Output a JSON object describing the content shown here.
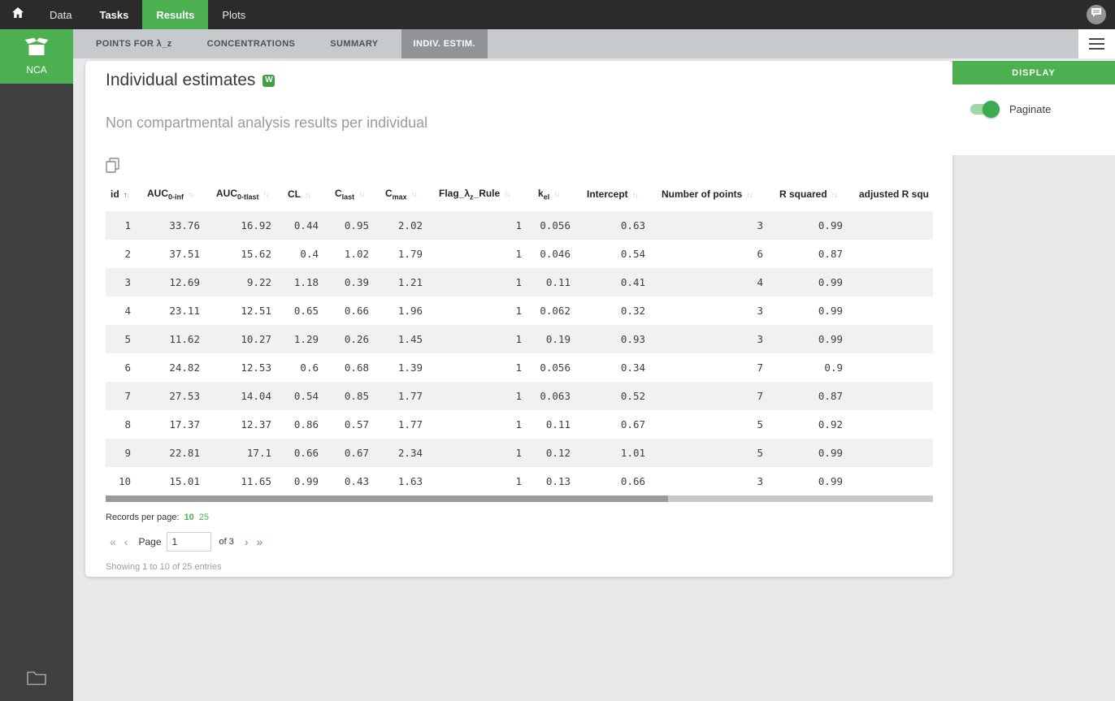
{
  "topbar": {
    "nav": [
      {
        "label": "Data"
      },
      {
        "label": "Tasks"
      },
      {
        "label": "Results"
      },
      {
        "label": "Plots"
      }
    ]
  },
  "result_tabs": [
    {
      "label": "POINTS FOR λ_z"
    },
    {
      "label": "CONCENTRATIONS"
    },
    {
      "label": "SUMMARY"
    },
    {
      "label": "INDIV. ESTIM."
    }
  ],
  "sidebar": {
    "project_label": "NCA"
  },
  "main": {
    "title": "Individual estimates",
    "word_icon_letter": "W",
    "subtitle": "Non compartmental analysis results per individual",
    "table": {
      "headers": [
        {
          "base": "id",
          "sub": "",
          "suffix": "",
          "sorted": "asc"
        },
        {
          "base": "AUC",
          "sub": "0-inf",
          "suffix": "",
          "sorted": ""
        },
        {
          "base": "AUC",
          "sub": "0-tlast",
          "suffix": "",
          "sorted": ""
        },
        {
          "base": "CL",
          "sub": "",
          "suffix": "",
          "sorted": ""
        },
        {
          "base": "C",
          "sub": "last",
          "suffix": "",
          "sorted": ""
        },
        {
          "base": "C",
          "sub": "max",
          "suffix": "",
          "sorted": ""
        },
        {
          "base": "Flag_λ",
          "sub": "z",
          "suffix": "_Rule",
          "sorted": ""
        },
        {
          "base": "k",
          "sub": "el",
          "suffix": "",
          "sorted": ""
        },
        {
          "base": "Intercept",
          "sub": "",
          "suffix": "",
          "sorted": ""
        },
        {
          "base": "Number of points",
          "sub": "",
          "suffix": "",
          "sorted": ""
        },
        {
          "base": "R squared",
          "sub": "",
          "suffix": "",
          "sorted": ""
        },
        {
          "base": "adjusted R squ",
          "sub": "",
          "suffix": "",
          "sorted": ""
        }
      ],
      "rows": [
        [
          "1",
          "33.76",
          "16.92",
          "0.44",
          "0.95",
          "2.02",
          "1",
          "0.056",
          "0.63",
          "3",
          "0.99",
          ""
        ],
        [
          "2",
          "37.51",
          "15.62",
          "0.4",
          "1.02",
          "1.79",
          "1",
          "0.046",
          "0.54",
          "6",
          "0.87",
          ""
        ],
        [
          "3",
          "12.69",
          "9.22",
          "1.18",
          "0.39",
          "1.21",
          "1",
          "0.11",
          "0.41",
          "4",
          "0.99",
          ""
        ],
        [
          "4",
          "23.11",
          "12.51",
          "0.65",
          "0.66",
          "1.96",
          "1",
          "0.062",
          "0.32",
          "3",
          "0.99",
          ""
        ],
        [
          "5",
          "11.62",
          "10.27",
          "1.29",
          "0.26",
          "1.45",
          "1",
          "0.19",
          "0.93",
          "3",
          "0.99",
          ""
        ],
        [
          "6",
          "24.82",
          "12.53",
          "0.6",
          "0.68",
          "1.39",
          "1",
          "0.056",
          "0.34",
          "7",
          "0.9",
          ""
        ],
        [
          "7",
          "27.53",
          "14.04",
          "0.54",
          "0.85",
          "1.77",
          "1",
          "0.063",
          "0.52",
          "7",
          "0.87",
          ""
        ],
        [
          "8",
          "17.37",
          "12.37",
          "0.86",
          "0.57",
          "1.77",
          "1",
          "0.11",
          "0.67",
          "5",
          "0.92",
          ""
        ],
        [
          "9",
          "22.81",
          "17.1",
          "0.66",
          "0.67",
          "2.34",
          "1",
          "0.12",
          "1.01",
          "5",
          "0.99",
          ""
        ],
        [
          "10",
          "15.01",
          "11.65",
          "0.99",
          "0.43",
          "1.63",
          "1",
          "0.13",
          "0.66",
          "3",
          "0.99",
          ""
        ]
      ]
    },
    "records_per_page": {
      "label": "Records per page:",
      "options": [
        "10",
        "25"
      ],
      "selected": "10"
    },
    "pagination": {
      "first": "«",
      "prev": "‹",
      "page_label": "Page",
      "current_page": "1",
      "of_label": "of 3",
      "next": "›",
      "last": "»"
    },
    "showing_text": "Showing 1 to 10 of 25 entries"
  },
  "display_panel": {
    "title": "DISPLAY",
    "paginate_label": "Paginate",
    "paginate_on": true
  },
  "colors": {
    "accent_green": "#4caf50",
    "topbar_bg": "#2b2b2b",
    "selected_tab_bg": "#909497"
  }
}
